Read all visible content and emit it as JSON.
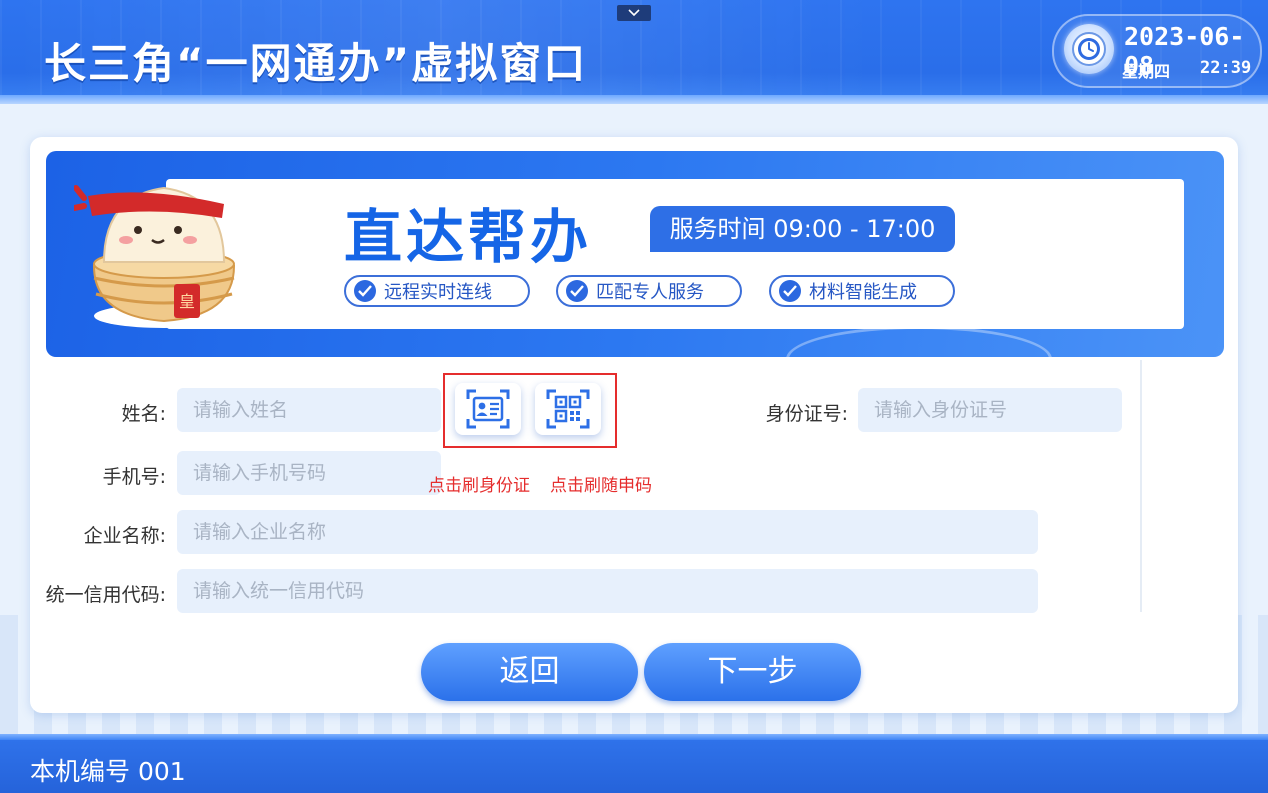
{
  "header": {
    "title": "长三角“一网通办”虚拟窗口",
    "date": "2023-06-08",
    "weekday": "星期四",
    "time": "22:39",
    "icons": {
      "clock": "clock-icon",
      "collapse": "chevron-down-icon"
    }
  },
  "banner": {
    "title": "直达帮办",
    "service_hours": "服务时间 09:00 - 17:00",
    "badges": [
      "远程实时连线",
      "匹配专人服务",
      "材料智能生成"
    ],
    "mascot": "steamed-bun-mascot",
    "mascot_seal_text": "皇"
  },
  "form": {
    "name": {
      "label": "姓名:",
      "placeholder": "请输入姓名",
      "value": ""
    },
    "id_number": {
      "label": "身份证号:",
      "placeholder": "请输入身份证号",
      "value": ""
    },
    "phone": {
      "label": "手机号:",
      "placeholder": "请输入手机号码",
      "value": ""
    },
    "company": {
      "label": "企业名称:",
      "placeholder": "请输入企业名称",
      "value": ""
    },
    "credit_code": {
      "label": "统一信用代码:",
      "placeholder": "请输入统一信用代码",
      "value": ""
    }
  },
  "scan": {
    "id_card_label": "点击刷身份证",
    "qr_label": "点击刷随申码",
    "highlight_color": "#e52d2d",
    "icons": [
      "id-card-icon",
      "qr-code-icon"
    ]
  },
  "actions": {
    "back": "返回",
    "next": "下一步"
  },
  "footer": {
    "machine_label": "本机编号 001"
  },
  "colors": {
    "accent": "#2b6fe8",
    "title_blue": "#1565e6",
    "alert_red": "#e52d2d"
  }
}
